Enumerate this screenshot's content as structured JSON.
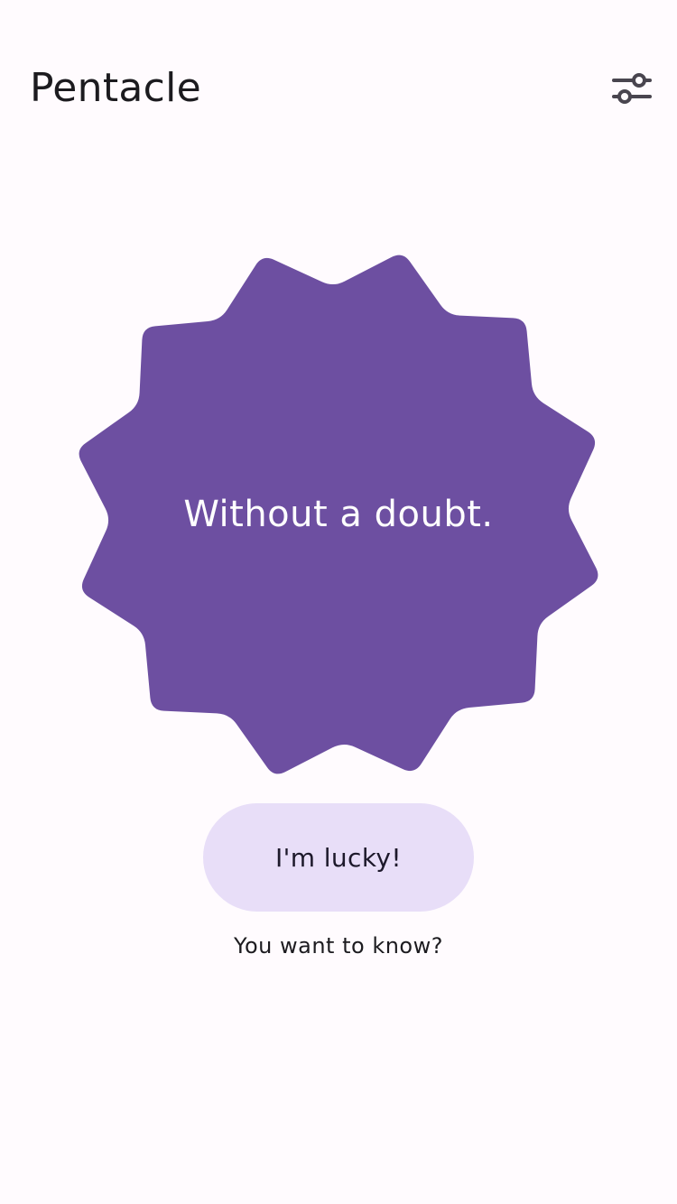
{
  "app": {
    "title": "Pentacle"
  },
  "toolbar": {
    "settings_icon": "tune-icon"
  },
  "oracle": {
    "answer": "Without a doubt.",
    "shape_color": "#6D4FA1"
  },
  "actions": {
    "lucky_label": "I'm lucky!",
    "lucky_bg": "#E8DEF8",
    "hint": "You want to know?"
  },
  "theme": {
    "background": "#FFFBFE"
  }
}
